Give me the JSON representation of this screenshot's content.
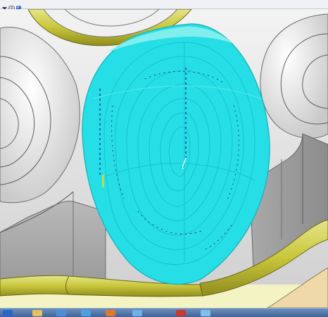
{
  "window": {
    "toolbar_icons": [
      {
        "icon": "dropdown-arrow-icon",
        "color": "#3a3a3a"
      },
      {
        "icon": "view-orientation-icon",
        "color": "#6c7a8d"
      },
      {
        "icon": "shading-mode-icon",
        "color": "#3b6bc9"
      }
    ]
  },
  "viewport": {
    "background": "#ffffff",
    "model_surface_color": "#dcdcdc",
    "rim_color": "#c8c63a",
    "toolpath_color": "#22dfe6",
    "selected_entity_color": "#1e2fa8"
  },
  "taskbar": {
    "items": [
      {
        "icon": "show-desktop-icon",
        "color": "#2a66c8"
      },
      {
        "icon": "folder-icon",
        "color": "#e8c060"
      },
      {
        "icon": "windows-explorer-icon",
        "color": "#4a8fd6"
      },
      {
        "icon": "internet-explorer-icon",
        "color": "#4fa0e0"
      },
      {
        "icon": "media-player-icon",
        "color": "#e0782a"
      },
      {
        "icon": "cam-application-icon",
        "color": "#6fb0e8"
      },
      {
        "icon": "cad-application-icon",
        "color": "#c43a32"
      },
      {
        "icon": "active-window-icon",
        "color": "#7fc0ea"
      }
    ]
  }
}
